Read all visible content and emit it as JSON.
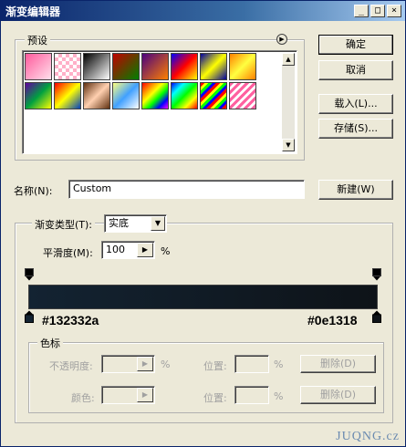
{
  "window": {
    "title": "渐变编辑器",
    "minimize": "_",
    "maximize": "□",
    "close": "×"
  },
  "presets": {
    "label": "预设",
    "swatches": [
      {
        "name": "preset-1",
        "css": "linear-gradient(135deg, #ff5a9c, #ffe0ec)"
      },
      {
        "name": "preset-2",
        "css": "repeating-conic-gradient(#ffb0c8 0 25%, #ffffff 0 50%) 0 0/8px 8px"
      },
      {
        "name": "preset-3",
        "css": "linear-gradient(135deg, #000000, #ffffff)"
      },
      {
        "name": "preset-4",
        "css": "linear-gradient(135deg, #c00000, #008000)"
      },
      {
        "name": "preset-5",
        "css": "linear-gradient(135deg, #4a0080, #ff8000)"
      },
      {
        "name": "preset-6",
        "css": "linear-gradient(135deg, #0000ff, #ff0000, #ffff00)"
      },
      {
        "name": "preset-7",
        "css": "linear-gradient(135deg, #0000a0, #ffff00, #0000a0)"
      },
      {
        "name": "preset-8",
        "css": "linear-gradient(135deg, #ff8000, #ffff40, #ff8000)"
      },
      {
        "name": "preset-9",
        "css": "linear-gradient(135deg, #6000a0, #00a040, #ffff00)"
      },
      {
        "name": "preset-10",
        "css": "linear-gradient(135deg, #ff0000, #ffff00, #0040c0)"
      },
      {
        "name": "preset-11",
        "css": "linear-gradient(135deg, #603010, #ffd0b0, #603010)"
      },
      {
        "name": "preset-12",
        "css": "linear-gradient(135deg, #ffff80, #40a0ff, #ffffff)"
      },
      {
        "name": "preset-13",
        "css": "linear-gradient(135deg, #ff0000, #ff8000, #ffff00, #00ff00, #0000ff, #ff00ff)"
      },
      {
        "name": "preset-14",
        "css": "linear-gradient(135deg, #0000ff, #00ffff, #00ff00, #ffff00, #ff0000)"
      },
      {
        "name": "preset-15",
        "css": "repeating-linear-gradient(135deg, #ff0000 0 3px, #ffff00 3px 6px, #00ff00 6px 9px, #0000ff 9px 12px)"
      },
      {
        "name": "preset-16",
        "css": "repeating-linear-gradient(135deg, #ff60a0 0 3px, #ffffff 3px 6px)"
      }
    ]
  },
  "buttons": {
    "ok": "确定",
    "cancel": "取消",
    "load": "载入(L)...",
    "save": "存储(S)...",
    "new": "新建(W)",
    "delete_opacity": "删除(D)",
    "delete_color": "删除(D)"
  },
  "name": {
    "label": "名称(N):",
    "value": "Custom"
  },
  "gradient_type": {
    "label": "渐变类型(T):",
    "value": "实底"
  },
  "smoothness": {
    "label": "平滑度(M):",
    "value": "100",
    "unit": "%"
  },
  "gradient": {
    "left_color": "#132332",
    "right_color": "#0e1318",
    "left_label": "#132332a",
    "right_label": "#0e1318"
  },
  "stops": {
    "label": "色标",
    "opacity_label": "不透明度:",
    "opacity_unit": "%",
    "opacity_location_label": "位置:",
    "opacity_location_unit": "%",
    "color_label": "颜色:",
    "color_location_label": "位置:",
    "color_location_unit": "%"
  },
  "watermark": "JUQNG.cz"
}
